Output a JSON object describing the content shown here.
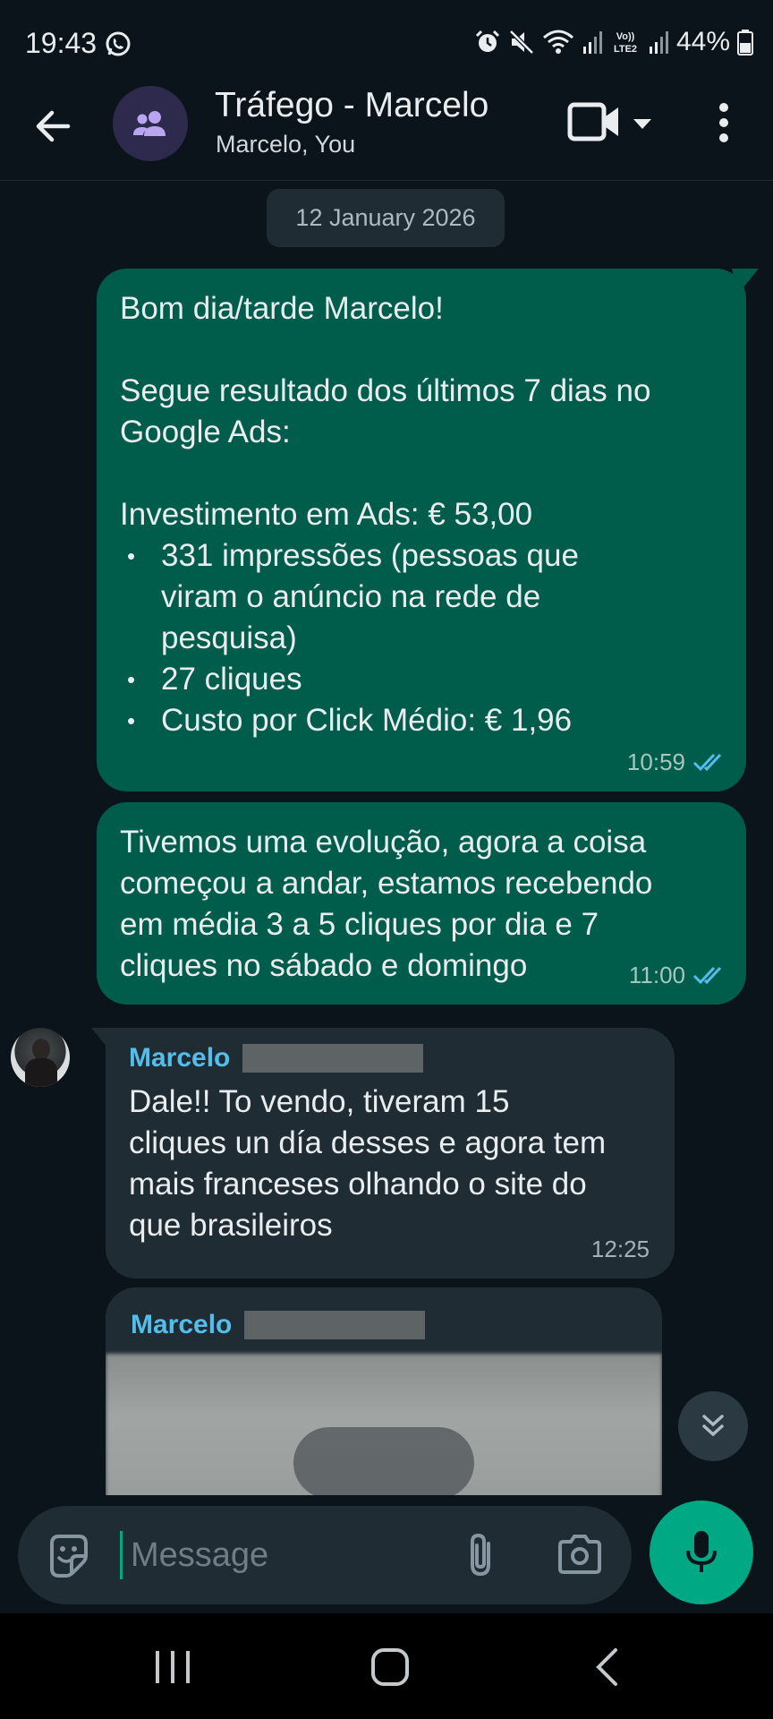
{
  "status_bar": {
    "time": "19:43",
    "battery": "44%",
    "icons": [
      "whatsapp-icon",
      "alarm-icon",
      "mute-icon",
      "wifi-icon",
      "signal-icon",
      "volte-icon",
      "signal2-icon",
      "battery-icon"
    ]
  },
  "header": {
    "title": "Tráfego - Marcelo",
    "subtitle": "Marcelo, You"
  },
  "chat": {
    "date_chip": "12 January 2026",
    "messages": [
      {
        "direction": "outgoing",
        "greeting": "Bom dia/tarde Marcelo!",
        "intro_line1": "Segue resultado dos últimos 7 dias no",
        "intro_line2": "Google Ads:",
        "investment": "Investimento em Ads: € 53,00",
        "bullets": [
          {
            "line1": "331 impressões (pessoas que",
            "line2": "viram o anúncio na rede de",
            "line3": "pesquisa)"
          },
          {
            "line1": "27 cliques"
          },
          {
            "line1": "Custo por Click Médio: € 1,96"
          }
        ],
        "time": "10:59"
      },
      {
        "direction": "outgoing",
        "line1": "Tivemos uma evolução, agora a coisa",
        "line2": "começou a andar, estamos recebendo",
        "line3": "em média 3 a 5 cliques por dia e 7",
        "line4": "cliques no sábado e domingo",
        "time": "11:00"
      },
      {
        "direction": "incoming",
        "sender": "Marcelo",
        "line1": "Dale!! To vendo, tiveram 15",
        "line2": "cliques un día desses e agora tem",
        "line3": "mais franceses olhando o site do",
        "line4": "que brasileiros",
        "time": "12:25"
      },
      {
        "direction": "incoming",
        "sender": "Marcelo",
        "type": "image"
      }
    ]
  },
  "composer": {
    "placeholder": "Message"
  },
  "colors": {
    "background": "#0b141a",
    "outgoing_bubble": "#005c4b",
    "incoming_bubble": "#202c33",
    "accent": "#00a884",
    "sender_name": "#53bdeb",
    "read_tick": "#53bdeb"
  }
}
